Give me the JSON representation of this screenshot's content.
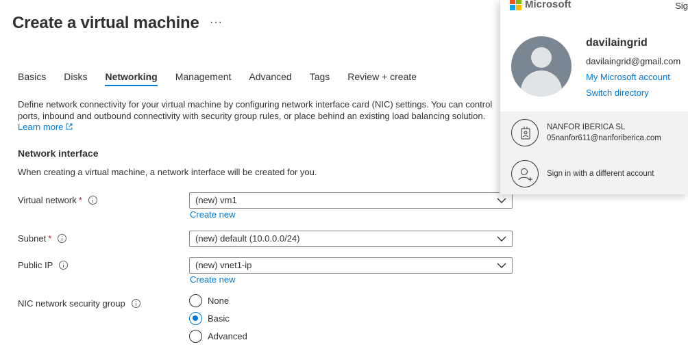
{
  "page": {
    "title": "Create a virtual machine",
    "more_label": "···"
  },
  "tabs": [
    {
      "label": "Basics"
    },
    {
      "label": "Disks"
    },
    {
      "label": "Networking",
      "active": true
    },
    {
      "label": "Management"
    },
    {
      "label": "Advanced"
    },
    {
      "label": "Tags"
    },
    {
      "label": "Review + create"
    }
  ],
  "intro": {
    "text": "Define network connectivity for your virtual machine by configuring network interface card (NIC) settings. You can control ports, inbound and outbound connectivity with security group rules, or place behind an existing load balancing solution.",
    "learn_more": "Learn more"
  },
  "network_interface": {
    "heading": "Network interface",
    "subtitle": "When creating a virtual machine, a network interface will be created for you."
  },
  "fields": {
    "virtual_network": {
      "label": "Virtual network",
      "required": "*",
      "value": "(new) vm1",
      "create_new": "Create new"
    },
    "subnet": {
      "label": "Subnet",
      "required": "*",
      "value": "(new) default (10.0.0.0/24)"
    },
    "public_ip": {
      "label": "Public IP",
      "value": "(new) vnet1-ip",
      "create_new": "Create new"
    },
    "nic_nsg": {
      "label": "NIC network security group",
      "options": [
        {
          "label": "None",
          "checked": false
        },
        {
          "label": "Basic",
          "checked": true
        },
        {
          "label": "Advanced",
          "checked": false
        }
      ]
    }
  },
  "account_panel": {
    "brand": "Microsoft",
    "sign_out": "Sig",
    "name": "davilaingrid",
    "email": "davilaingrid@gmail.com",
    "my_account_link": "My Microsoft account",
    "switch_directory_link": "Switch directory",
    "directory": {
      "org_name": "NANFOR IBERICA SL",
      "org_email": "05nanfor611@nanforiberica.com"
    },
    "other_account": "Sign in with a different account",
    "colors": {
      "ms_red": "#f25022",
      "ms_green": "#7fba00",
      "ms_blue": "#00a4ef",
      "ms_yellow": "#ffb900"
    }
  },
  "colors": {
    "accent": "#0078d4",
    "required": "#a4262c",
    "text": "#323130"
  }
}
